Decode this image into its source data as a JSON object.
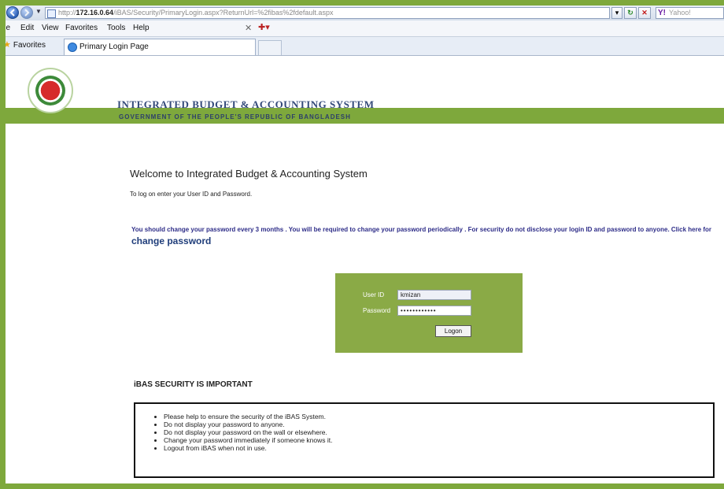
{
  "browser": {
    "address_prefix": "http://",
    "address_host": "172.16.0.64",
    "address_path": "/iBAS/Security/PrimaryLogin.aspx?ReturnUrl=%2fibas%2fdefault.aspx",
    "search_placeholder": "Yahoo!",
    "menu": [
      "ile",
      "Edit",
      "View",
      "Favorites",
      "Tools",
      "Help"
    ],
    "favorites_label": "Favorites",
    "tab_title": "Primary Login Page"
  },
  "header": {
    "title": "Integrated Budget & Accounting System",
    "subtitle": "Government of the People's Republic of Bangladesh"
  },
  "content": {
    "welcome": "Welcome to Integrated Budget & Accounting System",
    "instruction": "To log on enter your User ID and Password.",
    "notice": "You should change your password every 3 months . You will be required to change your password periodically . For security do not disclose your login ID and password to anyone. Click here for",
    "change_password_link": "change password"
  },
  "login": {
    "user_label": "User ID",
    "user_value": "kmizan",
    "password_label": "Password",
    "password_value": "••••••••••••",
    "button": "Logon"
  },
  "security": {
    "heading": "iBAS SECURITY IS IMPORTANT",
    "tips": [
      "Please help to ensure the security of the iBAS System.",
      "Do not display your password to anyone.",
      "Do not display your password on the wall or elsewhere.",
      "Change your password immediately if someone knows it.",
      "Logout from iBAS when not in use."
    ]
  },
  "icons": [
    "back-icon",
    "forward-icon",
    "page-icon",
    "refresh-icon",
    "stop-icon",
    "yahoo-icon",
    "favorites-star-icon",
    "ie-icon",
    "emblem-logo"
  ],
  "colors": {
    "brand_green": "#7ea83c",
    "panel_green": "#8aaa46",
    "title_blue": "#33497a",
    "notice_blue": "#2e2d88"
  }
}
